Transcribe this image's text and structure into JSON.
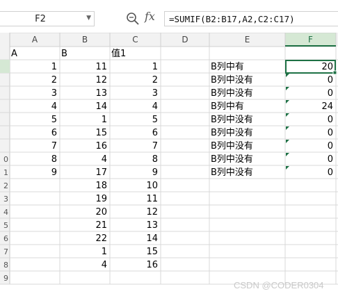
{
  "name_box": {
    "value": "F2"
  },
  "formula_bar": {
    "fx_label": "fx",
    "formula": "=SUMIF(B2:B17,A2,C2:C17)"
  },
  "columns": [
    "A",
    "B",
    "C",
    "D",
    "E",
    "F"
  ],
  "selected_cell": "F2",
  "row_headers": [
    "",
    "",
    "",
    "",
    "",
    "",
    "",
    "",
    "0",
    "1",
    "2",
    "3",
    "4",
    "5",
    "6",
    "7",
    "8",
    "9"
  ],
  "cells": {
    "A": [
      "A",
      "1",
      "2",
      "3",
      "4",
      "5",
      "6",
      "7",
      "8",
      "9",
      "",
      "",
      "",
      "",
      "",
      "",
      "",
      ""
    ],
    "B": [
      "B",
      "11",
      "12",
      "13",
      "14",
      "1",
      "15",
      "16",
      "4",
      "17",
      "18",
      "19",
      "20",
      "21",
      "22",
      "1",
      "4",
      ""
    ],
    "C": [
      "值1",
      "1",
      "2",
      "3",
      "4",
      "5",
      "6",
      "7",
      "8",
      "9",
      "10",
      "11",
      "12",
      "13",
      "14",
      "15",
      "16",
      ""
    ],
    "E": [
      "",
      "B列中有",
      "B列中没有",
      "B列中没有",
      "B列中有",
      "B列中没有",
      "B列中没有",
      "B列中没有",
      "B列中没有",
      "B列中没有",
      "",
      "",
      "",
      "",
      "",
      "",
      "",
      ""
    ],
    "F": [
      "",
      "20",
      "0",
      "0",
      "24",
      "0",
      "0",
      "0",
      "0",
      "0",
      "",
      "",
      "",
      "",
      "",
      "",
      "",
      ""
    ]
  },
  "watermark": "CSDN @CODER0304",
  "colors": {
    "accent": "#1e7145",
    "header_bg": "#f2f2f2",
    "selected_header_bg": "#d5e8d4",
    "gridline": "#d8d8d8"
  }
}
